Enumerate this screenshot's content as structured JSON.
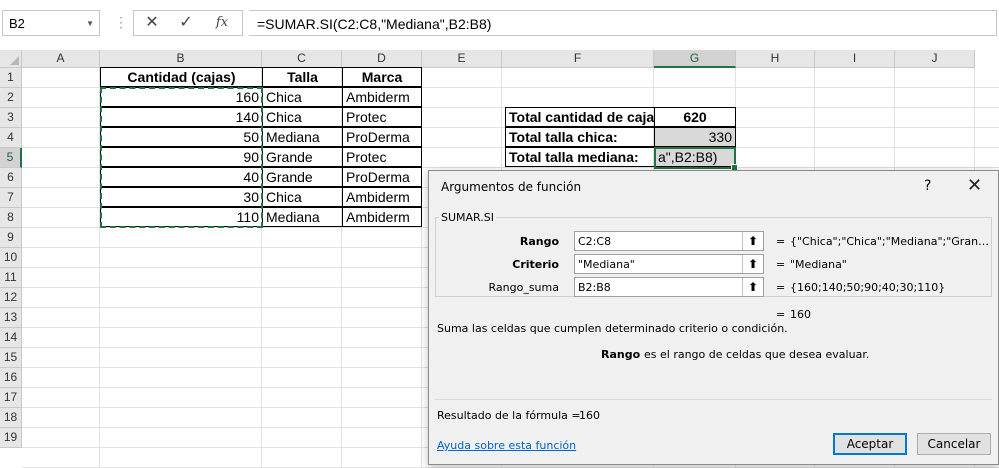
{
  "formula_bar": {
    "name_box": "B2",
    "cancel_icon": "✕",
    "enter_icon": "✓",
    "fx_icon": "fx",
    "formula": "=SUMAR.SI(C2:C8,\"Mediana\",B2:B8)"
  },
  "columns": [
    "A",
    "B",
    "C",
    "D",
    "E",
    "F",
    "G",
    "H",
    "I",
    "J"
  ],
  "selected_column": "G",
  "rows": [
    "1",
    "2",
    "3",
    "4",
    "5",
    "6",
    "7",
    "8",
    "9",
    "10",
    "11",
    "12",
    "13",
    "14",
    "15",
    "16",
    "17",
    "18",
    "19"
  ],
  "selected_row": "5",
  "table": {
    "headers": [
      "Cantidad (cajas)",
      "Talla",
      "Marca"
    ],
    "rows": [
      {
        "cantidad": "160",
        "talla": "Chica",
        "marca": "Ambiderm"
      },
      {
        "cantidad": "140",
        "talla": "Chica",
        "marca": "Protec"
      },
      {
        "cantidad": "50",
        "talla": "Mediana",
        "marca": "ProDerma"
      },
      {
        "cantidad": "90",
        "talla": "Grande",
        "marca": "Protec"
      },
      {
        "cantidad": "40",
        "talla": "Grande",
        "marca": "ProDerma"
      },
      {
        "cantidad": "30",
        "talla": "Chica",
        "marca": "Ambiderm"
      },
      {
        "cantidad": "110",
        "talla": "Mediana",
        "marca": "Ambiderm"
      }
    ]
  },
  "summary": [
    {
      "label": "Total cantidad de cajas:",
      "value": "620"
    },
    {
      "label": "Total talla chica:",
      "value": "330"
    },
    {
      "label": "Total talla mediana:",
      "value": "a\",B2:B8)"
    }
  ],
  "dialog": {
    "title": "Argumentos de función",
    "help_icon": "?",
    "close_icon": "✕",
    "function_name": "SUMAR.SI",
    "args": [
      {
        "label": "Rango",
        "value": "C2:C8",
        "result": "{\"Chica\";\"Chica\";\"Mediana\";\"Grande\"..."
      },
      {
        "label": "Criterio",
        "value": "\"Mediana\"",
        "result": "\"Mediana\""
      },
      {
        "label": "Rango_suma",
        "value": "B2:B8",
        "result": "{160;140;50;90;40;30;110}"
      }
    ],
    "arg_button_icon": "⬆",
    "equals": "=",
    "total_value": "160",
    "description": "Suma las celdas que cumplen determinado criterio o condición.",
    "arg_help_name": "Rango",
    "arg_help_text": "es el rango de celdas que desea evaluar.",
    "result_label": "Resultado de la fórmula =",
    "result_value": "160",
    "help_link": "Ayuda sobre esta función",
    "ok_label": "Aceptar",
    "cancel_label": "Cancelar"
  }
}
